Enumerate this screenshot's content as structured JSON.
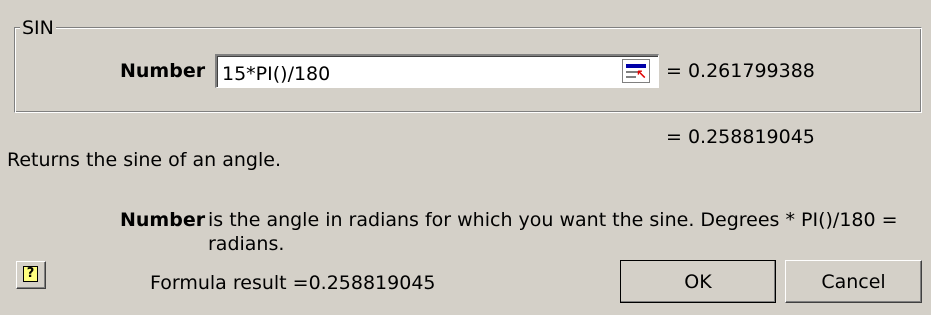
{
  "dialog": {
    "group_label": "SIN",
    "argument": {
      "label": "Number",
      "value": "15*PI()/180",
      "result": "= 0.261799388"
    },
    "formula_value": "= 0.258819045",
    "description": "Returns the sine of an angle.",
    "argument_help": {
      "label": "Number",
      "text": "is the angle in radians for which you want the sine. Degrees * PI()/180 = radians."
    },
    "formula_result": "Formula result =0.258819045",
    "buttons": {
      "ok": "OK",
      "cancel": "Cancel"
    },
    "icons": {
      "help": "help-icon",
      "collapse": "collapse-dialog-icon"
    }
  }
}
